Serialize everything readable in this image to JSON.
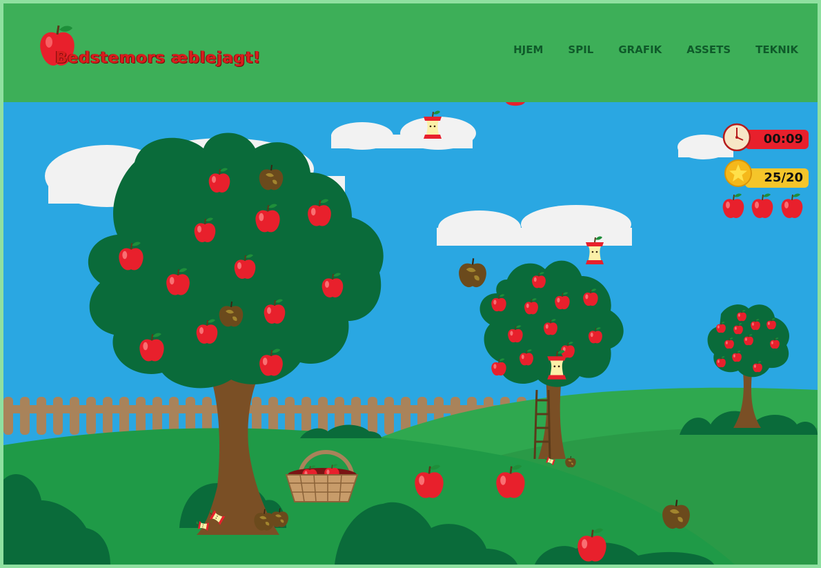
{
  "header": {
    "title": "Bedstemors æblejagt!",
    "nav": [
      {
        "label": "HJEM"
      },
      {
        "label": "SPIL"
      },
      {
        "label": "GRAFIK"
      },
      {
        "label": "ASSETS"
      },
      {
        "label": "TEKNIK"
      }
    ]
  },
  "hud": {
    "timer": "00:09",
    "score": "25/20",
    "lives": 3,
    "timer_icon": "stopwatch-icon",
    "score_icon": "gold-star-coin-icon",
    "life_icon": "red-apple-icon"
  },
  "colors": {
    "header_bg": "#3daf58",
    "sky": "#2aa7e2",
    "grass": "#2fa84f",
    "tree_canopy": "#0a6b3a",
    "apple_red": "#e8202c",
    "timer_bg": "#e8202c",
    "score_bg": "#f5c52a"
  }
}
